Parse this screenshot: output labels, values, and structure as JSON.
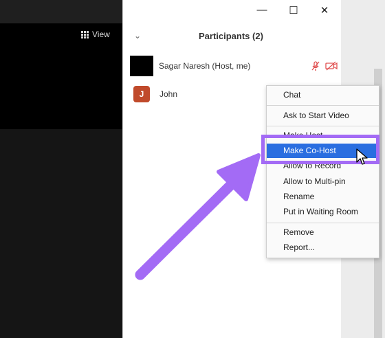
{
  "toolbar": {
    "view_label": "View"
  },
  "window_controls": {
    "minimize": "—",
    "maximize": "☐",
    "close": "✕"
  },
  "panel": {
    "title": "Participants (2)",
    "collapse_glyph": "⌄"
  },
  "participants": [
    {
      "name": "Sagar Naresh  (Host, me)",
      "mic_icon": "mic-muted-icon",
      "cam_icon": "camera-off-icon"
    },
    {
      "name": "John",
      "initial": "J"
    }
  ],
  "context_menu": {
    "items": [
      {
        "label": "Chat"
      },
      {
        "label": "Ask to Start Video"
      },
      {
        "label": "Make Host"
      },
      {
        "label": "Make Co-Host",
        "selected": true
      },
      {
        "label": "Allow to Record"
      },
      {
        "label": "Allow to Multi-pin"
      },
      {
        "label": "Rename"
      },
      {
        "label": "Put in Waiting Room"
      },
      {
        "label": "Remove"
      },
      {
        "label": "Report..."
      }
    ]
  },
  "annotation": {
    "arrow_color": "#a36bf5",
    "highlight_color": "#a36bf5"
  },
  "colors": {
    "selected_item": "#2a6ee0",
    "john_avatar": "#c04a2b",
    "muted_red": "#e05050"
  }
}
